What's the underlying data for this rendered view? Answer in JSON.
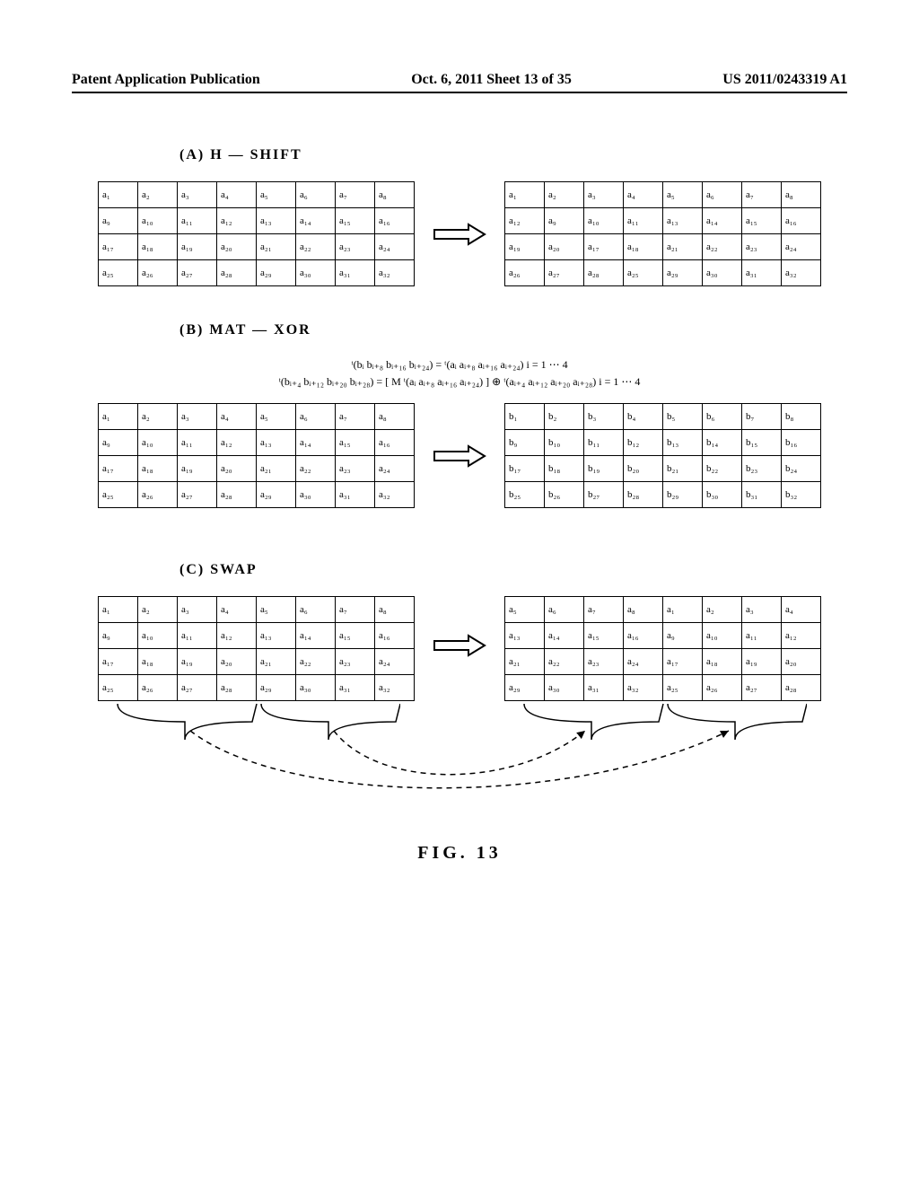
{
  "header": {
    "left": "Patent Application Publication",
    "center": "Oct. 6, 2011  Sheet 13 of 35",
    "right": "US 2011/0243319 A1"
  },
  "sections": {
    "a": {
      "label": "(A)  H — SHIFT"
    },
    "b": {
      "label": "(B)  MAT — XOR",
      "formula1": "ᵗ(bᵢ bᵢ₊₈ bᵢ₊₁₆ bᵢ₊₂₄) =  ᵗ(aᵢ aᵢ₊₈ aᵢ₊₁₆ aᵢ₊₂₄)      i = 1 ⋯ 4",
      "formula2": "ᵗ(bᵢ₊₄ bᵢ₊₁₂ bᵢ₊₂₀ bᵢ₊₂₈) = [ M ᵗ(aᵢ aᵢ₊₈ aᵢ₊₁₆ aᵢ₊₂₄) ] ⊕ ᵗ(aᵢ₊₄ aᵢ₊₁₂ aᵢ₊₂₀ aᵢ₊₂₈)      i = 1 ⋯ 4"
    },
    "c": {
      "label": "(C)  SWAP"
    }
  },
  "figure_label": "FIG. 13",
  "matA_in": [
    [
      "a₁",
      "a₂",
      "a₃",
      "a₄",
      "a₅",
      "a₆",
      "a₇",
      "a₈"
    ],
    [
      "a₉",
      "a₁₀",
      "a₁₁",
      "a₁₂",
      "a₁₃",
      "a₁₄",
      "a₁₅",
      "a₁₆"
    ],
    [
      "a₁₇",
      "a₁₈",
      "a₁₉",
      "a₂₀",
      "a₂₁",
      "a₂₂",
      "a₂₃",
      "a₂₄"
    ],
    [
      "a₂₅",
      "a₂₆",
      "a₂₇",
      "a₂₈",
      "a₂₉",
      "a₃₀",
      "a₃₁",
      "a₃₂"
    ]
  ],
  "matA_out": [
    [
      "a₁",
      "a₂",
      "a₃",
      "a₄",
      "a₅",
      "a₆",
      "a₇",
      "a₈"
    ],
    [
      "a₁₂",
      "a₉",
      "a₁₀",
      "a₁₁",
      "a₁₃",
      "a₁₄",
      "a₁₅",
      "a₁₆"
    ],
    [
      "a₁₉",
      "a₂₀",
      "a₁₇",
      "a₁₈",
      "a₂₁",
      "a₂₂",
      "a₂₃",
      "a₂₄"
    ],
    [
      "a₂₆",
      "a₂₇",
      "a₂₈",
      "a₂₅",
      "a₂₉",
      "a₃₀",
      "a₃₁",
      "a₃₂"
    ]
  ],
  "matB_in": [
    [
      "a₁",
      "a₂",
      "a₃",
      "a₄",
      "a₅",
      "a₆",
      "a₇",
      "a₈"
    ],
    [
      "a₉",
      "a₁₀",
      "a₁₁",
      "a₁₂",
      "a₁₃",
      "a₁₄",
      "a₁₅",
      "a₁₆"
    ],
    [
      "a₁₇",
      "a₁₈",
      "a₁₉",
      "a₂₀",
      "a₂₁",
      "a₂₂",
      "a₂₃",
      "a₂₄"
    ],
    [
      "a₂₅",
      "a₂₆",
      "a₂₇",
      "a₂₈",
      "a₂₉",
      "a₃₀",
      "a₃₁",
      "a₃₂"
    ]
  ],
  "matB_out": [
    [
      "b₁",
      "b₂",
      "b₃",
      "b₄",
      "b₅",
      "b₆",
      "b₇",
      "b₈"
    ],
    [
      "b₉",
      "b₁₀",
      "b₁₁",
      "b₁₂",
      "b₁₃",
      "b₁₄",
      "b₁₅",
      "b₁₆"
    ],
    [
      "b₁₇",
      "b₁₈",
      "b₁₉",
      "b₂₀",
      "b₂₁",
      "b₂₂",
      "b₂₃",
      "b₂₄"
    ],
    [
      "b₂₅",
      "b₂₆",
      "b₂₇",
      "b₂₈",
      "b₂₉",
      "b₃₀",
      "b₃₁",
      "b₃₂"
    ]
  ],
  "matC_in": [
    [
      "a₁",
      "a₂",
      "a₃",
      "a₄",
      "a₅",
      "a₆",
      "a₇",
      "a₈"
    ],
    [
      "a₉",
      "a₁₀",
      "a₁₁",
      "a₁₂",
      "a₁₃",
      "a₁₄",
      "a₁₅",
      "a₁₆"
    ],
    [
      "a₁₇",
      "a₁₈",
      "a₁₉",
      "a₂₀",
      "a₂₁",
      "a₂₂",
      "a₂₃",
      "a₂₄"
    ],
    [
      "a₂₅",
      "a₂₆",
      "a₂₇",
      "a₂₈",
      "a₂₉",
      "a₃₀",
      "a₃₁",
      "a₃₂"
    ]
  ],
  "matC_out": [
    [
      "a₅",
      "a₆",
      "a₇",
      "a₈",
      "a₁",
      "a₂",
      "a₃",
      "a₄"
    ],
    [
      "a₁₃",
      "a₁₄",
      "a₁₅",
      "a₁₆",
      "a₉",
      "a₁₀",
      "a₁₁",
      "a₁₂"
    ],
    [
      "a₂₁",
      "a₂₂",
      "a₂₃",
      "a₂₄",
      "a₁₇",
      "a₁₈",
      "a₁₉",
      "a₂₀"
    ],
    [
      "a₂₉",
      "a₃₀",
      "a₃₁",
      "a₃₂",
      "a₂₅",
      "a₂₆",
      "a₂₇",
      "a₂₈"
    ]
  ]
}
